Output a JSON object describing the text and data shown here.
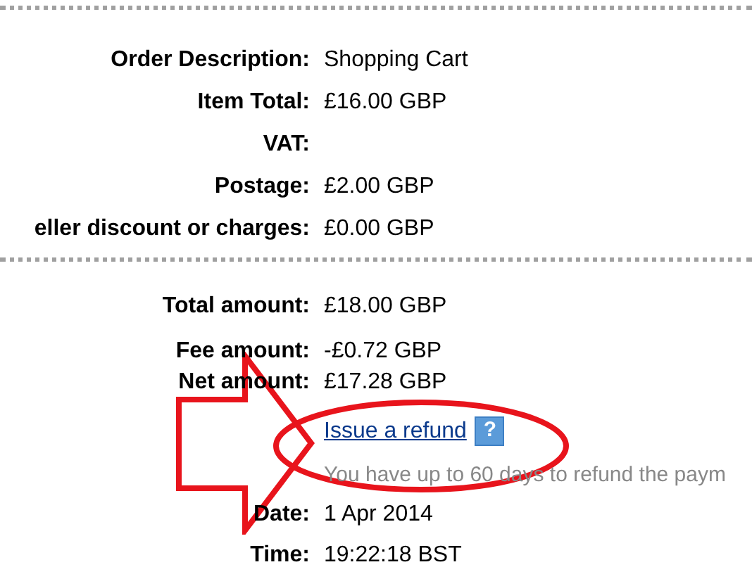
{
  "summary": [
    {
      "label": "Order Description:",
      "value": "Shopping Cart"
    },
    {
      "label": "Item Total:",
      "value": "£16.00 GBP"
    },
    {
      "label": "VAT:"
    },
    {
      "label": "Postage:",
      "value": "£2.00 GBP"
    },
    {
      "label": "eller discount or charges:",
      "value": "£0.00 GBP"
    }
  ],
  "amounts": [
    {
      "label": "Total amount:",
      "value": "£18.00 GBP"
    },
    {
      "label": "Fee amount:",
      "value": "-£0.72 GBP"
    },
    {
      "label": "Net amount:",
      "value": "£17.28 GBP"
    }
  ],
  "refund": {
    "link": "Issue a refund",
    "help": "?",
    "note": "You have up to 60 days to refund the paym"
  },
  "details": [
    {
      "label": "Date:",
      "value": "1 Apr 2014"
    },
    {
      "label": "Time:",
      "value": "19:22:18 BST"
    }
  ]
}
